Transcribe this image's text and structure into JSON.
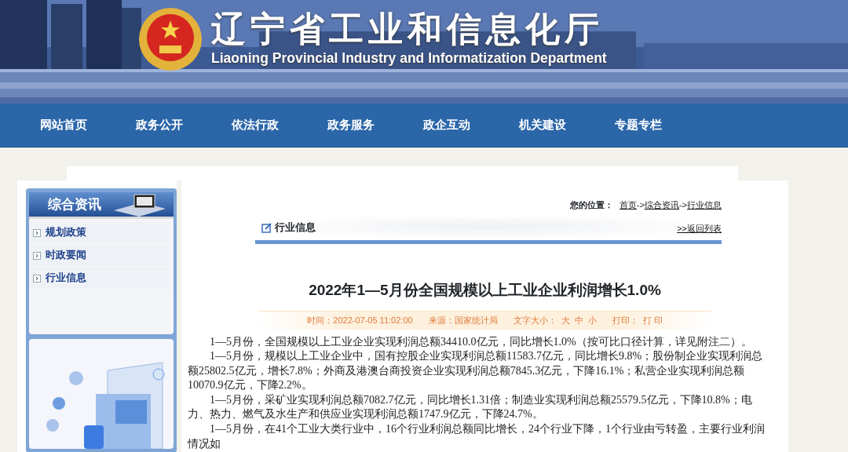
{
  "header": {
    "title": "辽宁省工业和信息化厅",
    "subtitle": "Liaoning Provincial Industry and Informatization Department"
  },
  "nav": [
    "网站首页",
    "政务公开",
    "依法行政",
    "政务服务",
    "政企互动",
    "机关建设",
    "专题专栏"
  ],
  "sidebar": {
    "heading": "综合资讯",
    "items": [
      {
        "label": "规划政策"
      },
      {
        "label": "时政要闻"
      },
      {
        "label": "行业信息"
      }
    ]
  },
  "breadcrumb": [
    {
      "kind": "label",
      "text": "您的位置："
    },
    {
      "kind": "link",
      "text": "首页"
    },
    {
      "kind": "separator",
      "text": "->"
    },
    {
      "kind": "link",
      "text": "综合资讯"
    },
    {
      "kind": "separator",
      "text": "->"
    },
    {
      "kind": "link",
      "text": "行业信息"
    }
  ],
  "section": {
    "title": "行业信息",
    "back_link": ">>返回列表"
  },
  "article": {
    "title": "2022年1—5月份全国规模以上工业企业利润增长1.0%",
    "meta": [
      {
        "kind": "text",
        "text": "时间：2022-07-05 11:02:00"
      },
      {
        "kind": "text",
        "text": "来源：国家统计局"
      },
      {
        "kind": "text",
        "text": "文字大小："
      },
      {
        "kind": "link",
        "text": "大"
      },
      {
        "kind": "link",
        "text": "中"
      },
      {
        "kind": "link",
        "text": "小"
      },
      {
        "kind": "text",
        "text": "打印："
      },
      {
        "kind": "link",
        "text": "打 印"
      }
    ],
    "paragraphs": [
      "1—5月份，全国规模以上工业企业实现利润总额34410.0亿元，同比增长1.0%（按可比口径计算，详见附注二）。",
      "1—5月份，规模以上工业企业中，国有控股企业实现利润总额11583.7亿元，同比增长9.8%；股份制企业实现利润总额25802.5亿元，增长7.8%；外商及港澳台商投资企业实现利润总额7845.3亿元，下降16.1%；私营企业实现利润总额10070.9亿元，下降2.2%。",
      "1—5月份，采矿业实现利润总额7082.7亿元，同比增长1.31倍；制造业实现利润总额25579.5亿元，下降10.8%；电力、热力、燃气及水生产和供应业实现利润总额1747.9亿元，下降24.7%。",
      "1—5月份，在41个工业大类行业中，16个行业利润总额同比增长，24个行业下降，1个行业由亏转盈，主要行业利润情况如"
    ]
  }
}
